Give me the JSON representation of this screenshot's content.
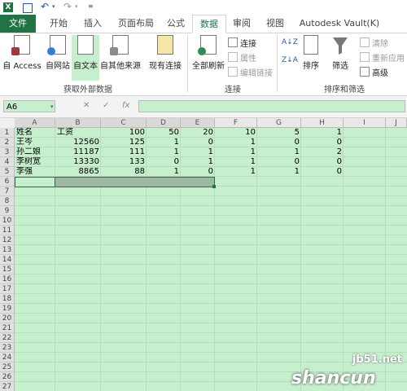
{
  "title_bar": {
    "excel_glyph": "X",
    "undo_glyph": "↶",
    "redo_glyph": "↷",
    "dropdown_glyph": "▾",
    "more_glyph": "≡"
  },
  "tabs": [
    {
      "label": "文件"
    },
    {
      "label": "开始"
    },
    {
      "label": "插入"
    },
    {
      "label": "页面布局"
    },
    {
      "label": "公式"
    },
    {
      "label": "数据"
    },
    {
      "label": "审阅"
    },
    {
      "label": "视图"
    },
    {
      "label": "Autodesk Vault(K)"
    }
  ],
  "ribbon": {
    "get_external": {
      "group_label": "获取外部数据",
      "buttons": [
        {
          "label": "自 Access"
        },
        {
          "label": "自网站"
        },
        {
          "label": "自文本"
        },
        {
          "label": "自其他来源"
        },
        {
          "label": "现有连接"
        }
      ]
    },
    "connections": {
      "group_label": "连接",
      "refresh_all": "全部刷新",
      "connections_label": "连接",
      "properties_label": "属性",
      "edit_links_label": "编辑链接"
    },
    "sort_filter": {
      "group_label": "排序和筛选",
      "sort_asc_icon": "A↓Z",
      "sort_desc_icon": "Z↓A",
      "sort_label": "排序",
      "filter_label": "筛选",
      "clear_label": "清除",
      "reapply_label": "重新应用",
      "advanced_label": "高级"
    }
  },
  "formula_bar": {
    "name_box": "A6",
    "cancel_symbol": "✕",
    "enter_symbol": "✓",
    "fx_symbol": "fx",
    "formula_value": ""
  },
  "grid": {
    "columns": [
      "A",
      "B",
      "C",
      "D",
      "E",
      "F",
      "G",
      "H",
      "I",
      "J"
    ],
    "rows": [
      "1",
      "2",
      "3",
      "4",
      "5",
      "6",
      "7",
      "8",
      "9",
      "10",
      "11",
      "12",
      "13",
      "14",
      "15",
      "16",
      "17",
      "18",
      "19",
      "20",
      "21",
      "22",
      "23",
      "24",
      "25",
      "26",
      "27"
    ],
    "data": [
      [
        "姓名",
        "工资",
        "100",
        "50",
        "20",
        "10",
        "5",
        "1"
      ],
      [
        "王岑",
        "12560",
        "125",
        "1",
        "0",
        "1",
        "0",
        "0"
      ],
      [
        "孙二娘",
        "11187",
        "111",
        "1",
        "1",
        "1",
        "1",
        "2"
      ],
      [
        "李树宽",
        "13330",
        "133",
        "0",
        "1",
        "1",
        "0",
        "0"
      ],
      [
        "李强",
        "8865",
        "88",
        "1",
        "0",
        "1",
        "1",
        "0"
      ]
    ]
  },
  "watermark": {
    "site": "jb51.net",
    "brand": "shancun"
  }
}
